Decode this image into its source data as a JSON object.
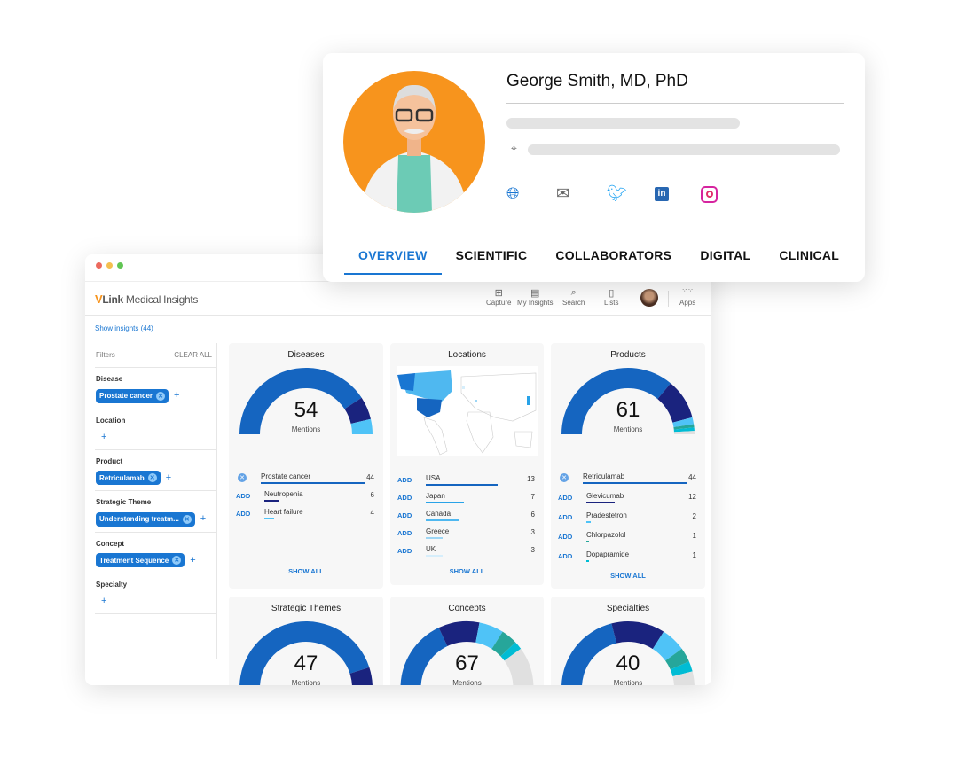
{
  "colors": {
    "accent": "#1976d2",
    "primary": "#1565c0",
    "navy": "#1a237e",
    "light": "#4fc3f7",
    "teal": "#26a69a",
    "cyan": "#00bcd4",
    "empty": "#e0e0e0",
    "avatar_bg": "#f7941d"
  },
  "profile": {
    "name": "George Smith, MD, PhD",
    "social_icons": [
      "globe-icon",
      "mail-icon",
      "twitter-icon",
      "linkedin-icon",
      "instagram-icon"
    ],
    "tabs": [
      {
        "label": "OVERVIEW",
        "active": true
      },
      {
        "label": "SCIENTIFIC"
      },
      {
        "label": "COLLABORATORS"
      },
      {
        "label": "DIGITAL"
      },
      {
        "label": "CLINICAL"
      }
    ]
  },
  "app": {
    "logo_mark": "V",
    "logo_link": "Link",
    "logo_rest": " Medical Insights",
    "nav": [
      {
        "label": "Capture",
        "icon": "⊞"
      },
      {
        "label": "My Insights",
        "icon": "📋"
      },
      {
        "label": "Search",
        "icon": "🔍"
      },
      {
        "label": "Lists",
        "icon": "🔖"
      }
    ],
    "apps_label": "Apps",
    "show_insights": "Show insights (44)"
  },
  "filters": {
    "title": "Filters",
    "clear": "CLEAR ALL",
    "sections": [
      {
        "label": "Disease",
        "chip": "Prostate cancer"
      },
      {
        "label": "Location",
        "chip": null
      },
      {
        "label": "Product",
        "chip": "Retriculamab"
      },
      {
        "label": "Strategic Theme",
        "chip": "Understanding treatm..."
      },
      {
        "label": "Concept",
        "chip": "Treatment Sequence"
      },
      {
        "label": "Specialty",
        "chip": null
      }
    ]
  },
  "cards": {
    "diseases": {
      "title": "Diseases",
      "total": "54",
      "unit": "Mentions",
      "show_all": "SHOW ALL",
      "items": [
        {
          "name": "Prostate cancer",
          "value": 44,
          "selected": true,
          "color": "#1565c0"
        },
        {
          "name": "Neutropenia",
          "value": 6,
          "color": "#1a237e"
        },
        {
          "name": "Heart failure",
          "value": 4,
          "color": "#4fc3f7"
        }
      ]
    },
    "locations": {
      "title": "Locations",
      "show_all": "SHOW ALL",
      "add": "ADD",
      "items": [
        {
          "name": "USA",
          "value": 13,
          "color": "#1565c0"
        },
        {
          "name": "Japan",
          "value": 7,
          "color": "#29a3e8"
        },
        {
          "name": "Canada",
          "value": 6,
          "color": "#4fb8f0"
        },
        {
          "name": "Greece",
          "value": 3,
          "color": "#9dd6f5"
        },
        {
          "name": "UK",
          "value": 3,
          "color": "#d6eefb"
        }
      ]
    },
    "products": {
      "title": "Products",
      "total": "61",
      "unit": "Mentions",
      "show_all": "SHOW ALL",
      "items": [
        {
          "name": "Retriculamab",
          "value": 44,
          "selected": true,
          "color": "#1565c0"
        },
        {
          "name": "Glevicumab",
          "value": 12,
          "color": "#1a237e"
        },
        {
          "name": "Pradestetron",
          "value": 2,
          "color": "#4fc3f7"
        },
        {
          "name": "Chlorpazolol",
          "value": 1,
          "color": "#26a69a"
        },
        {
          "name": "Dopapramide",
          "value": 1,
          "color": "#00bcd4"
        }
      ]
    },
    "strategic_themes": {
      "title": "Strategic Themes",
      "total": "47",
      "unit": "Mentions",
      "segments": [
        {
          "f": 0.9,
          "color": "#1565c0"
        },
        {
          "f": 0.1,
          "color": "#1a237e"
        }
      ]
    },
    "concepts": {
      "title": "Concepts",
      "total": "67",
      "unit": "Mentions",
      "segments": [
        {
          "f": 0.36,
          "color": "#1565c0"
        },
        {
          "f": 0.2,
          "color": "#1a237e"
        },
        {
          "f": 0.12,
          "color": "#4fc3f7"
        },
        {
          "f": 0.08,
          "color": "#26a69a"
        },
        {
          "f": 0.04,
          "color": "#00bcd4"
        },
        {
          "f": 0.2,
          "color": "#e0e0e0"
        }
      ]
    },
    "specialties": {
      "title": "Specialties",
      "total": "40",
      "unit": "Mentions",
      "segments": [
        {
          "f": 0.42,
          "color": "#1565c0"
        },
        {
          "f": 0.26,
          "color": "#1a237e"
        },
        {
          "f": 0.12,
          "color": "#4fc3f7"
        },
        {
          "f": 0.07,
          "color": "#26a69a"
        },
        {
          "f": 0.05,
          "color": "#00bcd4"
        },
        {
          "f": 0.08,
          "color": "#e0e0e0"
        }
      ]
    }
  },
  "add_label": "ADD"
}
